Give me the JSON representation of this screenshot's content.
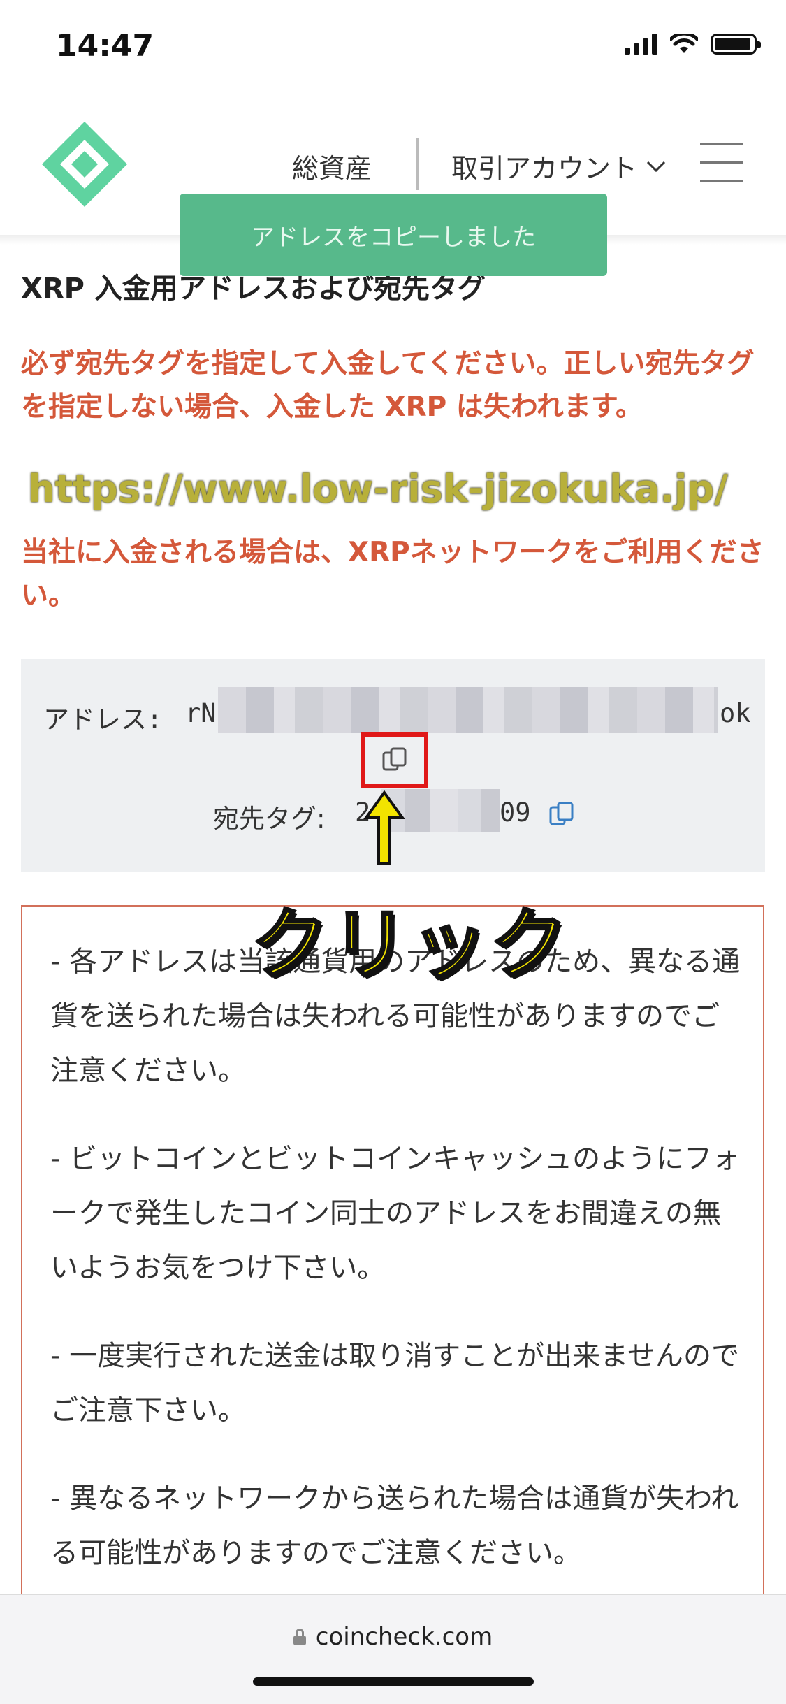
{
  "status_bar": {
    "time": "14:47"
  },
  "header": {
    "logo": "coincheck-logo-icon",
    "nav_assets": "総資産",
    "nav_account": "取引アカウント",
    "menu_icon": "hamburger-menu-icon"
  },
  "toast": {
    "message": "アドレスをコピーしました"
  },
  "page_title": "XRP 入金用アドレスおよび宛先タグ",
  "warning": "必ず宛先タグを指定して入金してください。正しい宛先タグを指定しない場合、入金した XRP は失われます。",
  "overlay_url": "https://www.low-risk-jizokuka.jp/",
  "network_note": "当社に入金される場合は、XRPネットワークをご利用ください。",
  "address": {
    "label": "アドレス:",
    "prefix": "rN",
    "suffix": "ok"
  },
  "tag": {
    "label": "宛先タグ:",
    "prefix": "2",
    "suffix": "09"
  },
  "annotation": {
    "click_label": "クリック",
    "highlight_color": "#e01818",
    "arrow_color": "#f2e300"
  },
  "notes": [
    "- 各アドレスは当該通貨用のアドレスのため、異なる通貨を送られた場合は失われる可能性がありますのでご注意ください。",
    "- ビットコインとビットコインキャッシュのようにフォークで発生したコイン同士のアドレスをお間違えの無いようお気をつけ下さい。",
    "- 一度実行された送金は取り消すことが出来ませんのでご注意下さい。",
    "- 異なるネットワークから送られた場合は通貨が失われる可能性がありますのでご注意ください。"
  ],
  "browser": {
    "url": "coincheck.com"
  },
  "colors": {
    "brand": "#57b98b",
    "warning": "#d4583a",
    "copy_icon": "#3a7fc4"
  }
}
